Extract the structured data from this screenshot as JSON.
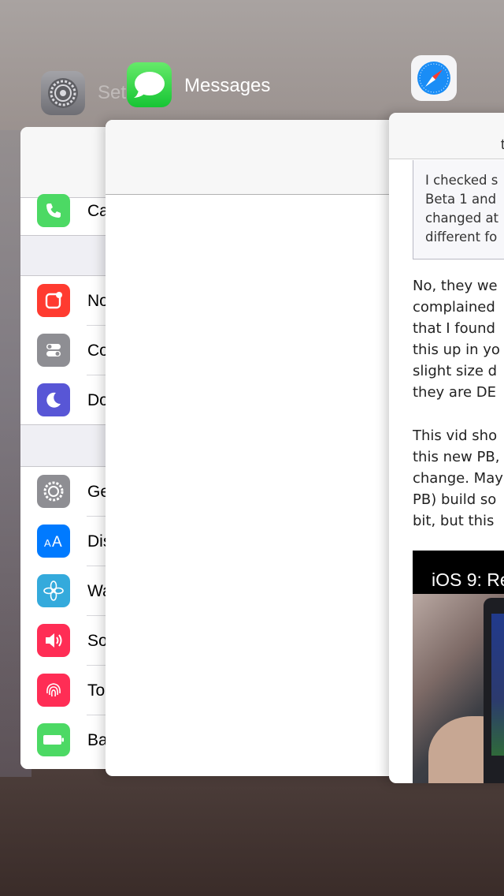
{
  "app_switcher": {
    "apps": [
      {
        "name": "Settings",
        "visible_label": "Set",
        "icon": "gear-icon"
      },
      {
        "name": "Messages",
        "icon": "speech-bubble-icon"
      },
      {
        "name": "Safari",
        "icon": "compass-icon"
      }
    ]
  },
  "settings_card": {
    "groups": [
      {
        "rows": [
          {
            "label": "Ca",
            "icon": "phone-icon",
            "color": "#4cd964"
          }
        ]
      },
      {
        "rows": [
          {
            "label": "No",
            "icon": "notifications-icon",
            "color": "#ff3b30"
          },
          {
            "label": "Co",
            "icon": "control-center-icon",
            "color": "#8e8e93"
          },
          {
            "label": "Do",
            "icon": "moon-icon",
            "color": "#5856d6"
          }
        ]
      },
      {
        "rows": [
          {
            "label": "Ge",
            "icon": "gear-icon",
            "color": "#8e8e93"
          },
          {
            "label": "Dis",
            "icon": "text-size-icon",
            "color": "#007aff"
          },
          {
            "label": "Wa",
            "icon": "flower-icon",
            "color": "#34aadc"
          },
          {
            "label": "So",
            "icon": "speaker-icon",
            "color": "#ff2d55"
          },
          {
            "label": "To",
            "icon": "fingerprint-icon",
            "color": "#ff2d55"
          },
          {
            "label": "Ba",
            "icon": "battery-icon",
            "color": "#4cd964"
          }
        ]
      }
    ]
  },
  "safari_card": {
    "nav_text": "t",
    "quote": [
      "I checked s",
      "Beta 1 and",
      "changed at",
      "different fo"
    ],
    "paragraph1": [
      "No, they we",
      "complained",
      "that I found",
      "this up in yo",
      "slight size d",
      "they are DE"
    ],
    "paragraph2": [
      "This vid sho",
      "this new PB,",
      "change. May",
      "PB) build so",
      "bit, but this"
    ],
    "video_title": "iOS 9: Re"
  }
}
